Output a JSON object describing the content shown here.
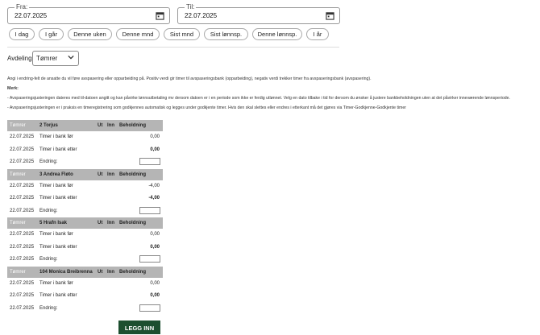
{
  "filters": {
    "from_label": "Fra:",
    "from_value": "22.07.2025",
    "to_label": "Til:",
    "to_value": "22.07.2025",
    "quick": [
      "I dag",
      "I går",
      "Denne uken",
      "Denne mnd",
      "Sist mnd",
      "Sist lønnsp.",
      "Denne lønnsp.",
      "I år"
    ]
  },
  "department": {
    "label": "Avdeling:",
    "value": "Tømrer"
  },
  "info": {
    "line1": "Angi i endring-felt de ansatte du vil føre avspasering eller opparbeiding på. Positiv verdi gir timer til avspaseringsbank (opparbeiding), negativ verdi trekker timer fra avspaseringsbank (avspasering).",
    "note_label": "Merk:",
    "line2": "- Avspaseringsjusteringen dateres med til-datoen angitt og kan påvirke lønnsutbetaling mv dersom datoen er i en periode som ikke er ferdig utlønnet. Velg en dato tilbake i tid for dersom du ønsker å justere bankbeholdningen uten at det påvirker inneværende lønnsperiode.",
    "line3": "- Avspaseringsjusteringen er i praksis en timeregistrering som godkjennes automatisk og legges under godkjente timer. Hvis den skal slettes eller endres i etterkant må det gjøres via Timer-Godkjenne-Godkjente timer"
  },
  "table": {
    "col_ut": "Ut",
    "col_inn": "Inn",
    "col_beh": "Beholdning",
    "label_before": "Timer i bank før",
    "label_after": "Timer i bank etter",
    "label_change": "Endring:",
    "groups": [
      {
        "dept": "Tømrer",
        "employee": "2 Torjus",
        "date": "22.07.2025",
        "before": "0,00",
        "after": "0,00"
      },
      {
        "dept": "Tømrer",
        "employee": "3 Andrea Fløto",
        "date": "22.07.2025",
        "before": "-4,00",
        "after": "-4,00"
      },
      {
        "dept": "Tømrer",
        "employee": "5 Hrafn Isak",
        "date": "22.07.2025",
        "before": "0,00",
        "after": "0,00"
      },
      {
        "dept": "Tømrer",
        "employee": "104 Monica Breibrenna",
        "date": "22.07.2025",
        "before": "0,00",
        "after": "0,00"
      }
    ]
  },
  "submit_label": "LEGG INN"
}
